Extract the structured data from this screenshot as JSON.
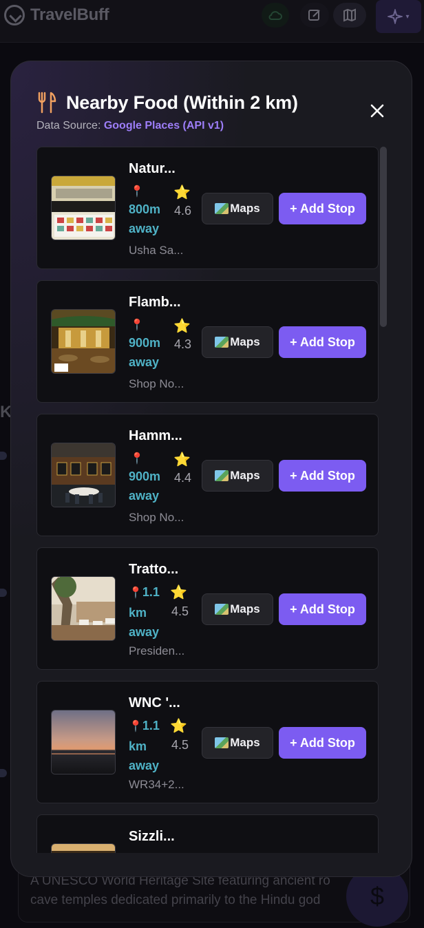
{
  "app": {
    "brand": "TravelBuff",
    "bg_description_line1": "A UNESCO World Heritage Site featuring ancient ro",
    "bg_description_line2": "cave temples dedicated primarily to the Hindu god",
    "bg_heading_fragment": "K",
    "fab_symbol": "$",
    "ai_chevron": "▾"
  },
  "modal": {
    "title": "Nearby Food (Within 2 km)",
    "source_label": "Data Source: ",
    "source_value": "Google Places (API v1)",
    "close_symbol": "✕",
    "maps_label": "Maps",
    "add_stop_label": "+ Add Stop",
    "pin_symbol": "📍",
    "star_symbol": "⭐"
  },
  "restaurants": [
    {
      "name": "Natur...",
      "distance": "800m away",
      "rating": "4.6",
      "address": "Usha Sa..."
    },
    {
      "name": "Flamb...",
      "distance": "900m away",
      "rating": "4.3",
      "address": "Shop No..."
    },
    {
      "name": "Hamm...",
      "distance": "900m away",
      "rating": "4.4",
      "address": "Shop No..."
    },
    {
      "name": "Tratto...",
      "distance": "1.1 km away",
      "rating": "4.5",
      "address": "Presiden..."
    },
    {
      "name": "WNC '...",
      "distance": "1.1 km away",
      "rating": "4.5",
      "address": "WR34+2..."
    },
    {
      "name": "Sizzli...",
      "distance": "",
      "rating": "",
      "address": ""
    }
  ],
  "colors": {
    "accent": "#7c5cf1",
    "link": "#9d7ef8",
    "distance": "#4fb2c6",
    "card_bg": "#0f0f13",
    "modal_bg": "#1a1a20"
  }
}
